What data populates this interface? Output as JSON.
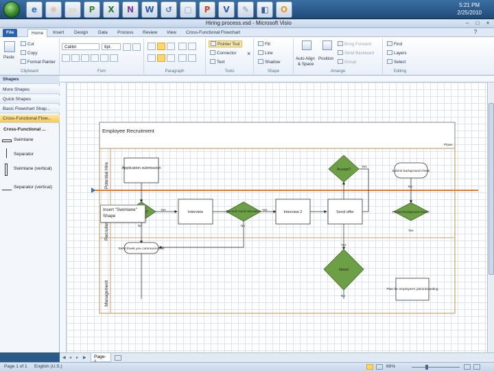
{
  "taskbar": {
    "apps": [
      {
        "icon": "internet-explorer-icon",
        "glyph": "e",
        "color": "#2a77c8"
      },
      {
        "icon": "firefox-icon",
        "glyph": "☼",
        "color": "#e07b22"
      },
      {
        "icon": "folder-icon",
        "glyph": "▭",
        "color": "#e6c25a"
      },
      {
        "icon": "project-icon",
        "glyph": "P",
        "color": "#3d8a3a"
      },
      {
        "icon": "excel-icon",
        "glyph": "X",
        "color": "#1f7a3a"
      },
      {
        "icon": "onenote-icon",
        "glyph": "N",
        "color": "#7b3e9c"
      },
      {
        "icon": "word-icon",
        "glyph": "W",
        "color": "#2a5aa8"
      },
      {
        "icon": "sync-icon",
        "glyph": "↺",
        "color": "#3b73b8"
      },
      {
        "icon": "media-icon",
        "glyph": "▢",
        "color": "#8aa5c5"
      },
      {
        "icon": "powerpoint-icon",
        "glyph": "P",
        "color": "#c9472a"
      },
      {
        "icon": "visio-icon",
        "glyph": "V",
        "color": "#2b5fb0"
      },
      {
        "icon": "tools-icon",
        "glyph": "✎",
        "color": "#8a9aa8"
      },
      {
        "icon": "network-icon",
        "glyph": "◧",
        "color": "#3d5d99"
      },
      {
        "icon": "outlook-icon",
        "glyph": "O",
        "color": "#e39a22"
      }
    ],
    "clock_time": "5:21 PM",
    "clock_date": "2/25/2010"
  },
  "window": {
    "title": "Hiring process.vsd  -  Microsoft Visio"
  },
  "ribbon_tabs": [
    {
      "label": "File"
    },
    {
      "label": "Home"
    },
    {
      "label": "Insert"
    },
    {
      "label": "Design"
    },
    {
      "label": "Data"
    },
    {
      "label": "Process"
    },
    {
      "label": "Review"
    },
    {
      "label": "View"
    },
    {
      "label": "Cross-Functional Flowchart"
    }
  ],
  "ribbon": {
    "clipboard": {
      "paste": "Paste",
      "cut": "Cut",
      "copy": "Copy",
      "format_painter": "Format Painter",
      "label": "Clipboard"
    },
    "font": {
      "name": "Calibri",
      "size": "8pt.",
      "label": "Font"
    },
    "paragraph": {
      "label": "Paragraph"
    },
    "tools": {
      "pointer": "Pointer Tool",
      "connector": "Connector",
      "text": "Text",
      "label": "Tools"
    },
    "shape": {
      "fill": "Fill",
      "line": "Line",
      "shadow": "Shadow",
      "label": "Shape"
    },
    "arrange": {
      "auto_align": "Auto Align",
      "and_space": "& Space",
      "position": "Position",
      "bring_forward": "Bring Forward",
      "send_backward": "Send Backward",
      "group": "Group",
      "label": "Arrange"
    },
    "editing": {
      "find": "Find",
      "layers": "Layers",
      "select": "Select",
      "label": "Editing"
    }
  },
  "shapes_pane": {
    "title": "Shapes",
    "rows": [
      "More Shapes",
      "Quick Shapes",
      "Basic Flowchart Shap...",
      "Cross-Functional Flow..."
    ],
    "stencil_header": "Cross-Functional ...",
    "stencils": [
      "Swimlane",
      "Separator",
      "Swimlane (vertical)",
      "Separator (vertical)"
    ]
  },
  "diagram": {
    "title": "Employee Recruitment",
    "phase": "Phase",
    "lanes": [
      "Potential Hire",
      "Recruiter",
      "Management"
    ],
    "shapes": {
      "app_submission": "Application submission",
      "fits_role": "Fits role?",
      "interview": "Interview",
      "second_round": "Second round interview?",
      "interview2": "Interview 2",
      "send_offer": "Send offer",
      "accept": "Accept?",
      "background": "Submit background check",
      "passed": "Passed background check?",
      "thank_you": "Send thank you communication",
      "hired": "Hired",
      "plan": "Plan for employee's job/onboarding"
    },
    "labels": {
      "yes": "Yes",
      "no": "No"
    }
  },
  "tooltip": "Insert \"Swimlane\" Shape",
  "pages": {
    "current": "Page-1"
  },
  "status": {
    "page": "Page 1 of 1",
    "language": "English (U.S.)",
    "zoom": "69%"
  }
}
